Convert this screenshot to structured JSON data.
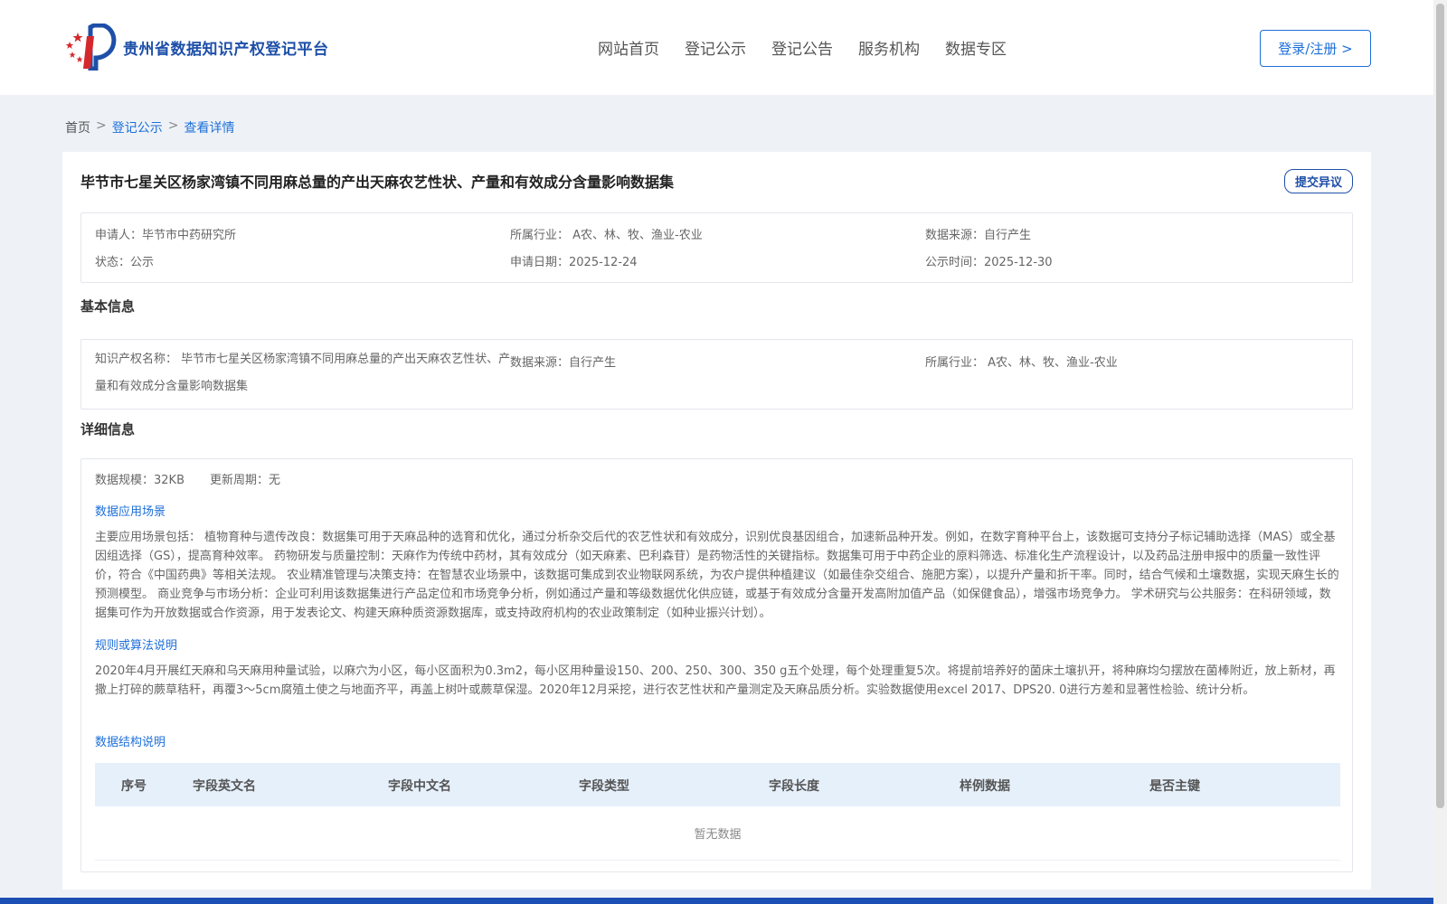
{
  "header": {
    "logo_text": "贵州省数据知识产权登记平台",
    "nav": [
      "网站首页",
      "登记公示",
      "登记公告",
      "服务机构",
      "数据专区"
    ],
    "login_label": "登录/注册 >"
  },
  "breadcrumb": {
    "home": "首页",
    "sep1": ">",
    "link1": "登记公示",
    "sep2": ">",
    "current": "查看详情"
  },
  "detail": {
    "title": "毕节市七星关区杨家湾镇不同用麻总量的产出天麻农艺性状、产量和有效成分含量影响数据集",
    "objection_label": "提交异议",
    "meta": {
      "applicant_label": "申请人：",
      "applicant": "毕节市中药研究所",
      "industry_label": "所属行业：",
      "industry": "A农、林、牧、渔业-农业",
      "source_label": "数据来源：",
      "source": "自行产生",
      "status_label": "状态：",
      "status": "公示",
      "apply_date_label": "申请日期：",
      "apply_date": "2025-12-24",
      "publish_date_label": "公示时间：",
      "publish_date": "2025-12-30"
    }
  },
  "basic": {
    "section_title": "基本信息",
    "ip_name_label": "知识产权名称：",
    "ip_name": "毕节市七星关区杨家湾镇不同用麻总量的产出天麻农艺性状、产量和有效成分含量影响数据集",
    "source_label": "数据来源：",
    "source": "自行产生",
    "industry_label": "所属行业：",
    "industry": "A农、林、牧、渔业-农业"
  },
  "details": {
    "section_title": "详细信息",
    "scale_label": "数据规模：",
    "scale": "32KB",
    "cycle_label": "更新周期：",
    "cycle": "无",
    "scenario_title": "数据应用场景",
    "scenario_text": "主要应用场景包括： 植物育种与遗传改良：数据集可用于天麻品种的选育和优化，通过分析杂交后代的农艺性状和有效成分，识别优良基因组合，加速新品种开发。例如，在数字育种平台上，该数据可支持分子标记辅助选择（MAS）或全基因组选择（GS），提高育种效率。 药物研发与质量控制：天麻作为传统中药材，其有效成分（如天麻素、巴利森苷）是药物活性的关键指标。数据集可用于中药企业的原料筛选、标准化生产流程设计，以及药品注册申报中的质量一致性评价，符合《中国药典》等相关法规。 农业精准管理与决策支持：在智慧农业场景中，该数据可集成到农业物联网系统，为农户提供种植建议（如最佳杂交组合、施肥方案），以提升产量和折干率。同时，结合气候和土壤数据，实现天麻生长的预测模型。 商业竞争与市场分析：企业可利用该数据集进行产品定位和市场竞争分析，例如通过产量和等级数据优化供应链，或基于有效成分含量开发高附加值产品（如保健食品），增强市场竞争力。 学术研究与公共服务：在科研领域，数据集可作为开放数据或合作资源，用于发表论文、构建天麻种质资源数据库，或支持政府机构的农业政策制定（如种业振兴计划）。",
    "rules_title": "规则或算法说明",
    "rules_text": "2020年4月开展红天麻和乌天麻用种量试验，以麻穴为小区，每小区面积为0.3m2，每小区用种量设150、200、250、300、350 g五个处理，每个处理重复5次。将提前培养好的菌床土壤扒开，将种麻均匀摆放在菌棒附近，放上新材，再撒上打碎的蕨草秸秆，再覆3～5cm腐殖土使之与地面齐平，再盖上树叶或蕨草保湿。2020年12月采挖，进行农艺性状和产量测定及天麻品质分析。实验数据使用excel 2017、DPS20. 0进行方差和显著性检验、统计分析。",
    "structure_title": "数据结构说明",
    "table_headers": [
      "序号",
      "字段英文名",
      "字段中文名",
      "字段类型",
      "字段长度",
      "样例数据",
      "是否主键"
    ],
    "empty_text": "暂无数据"
  }
}
